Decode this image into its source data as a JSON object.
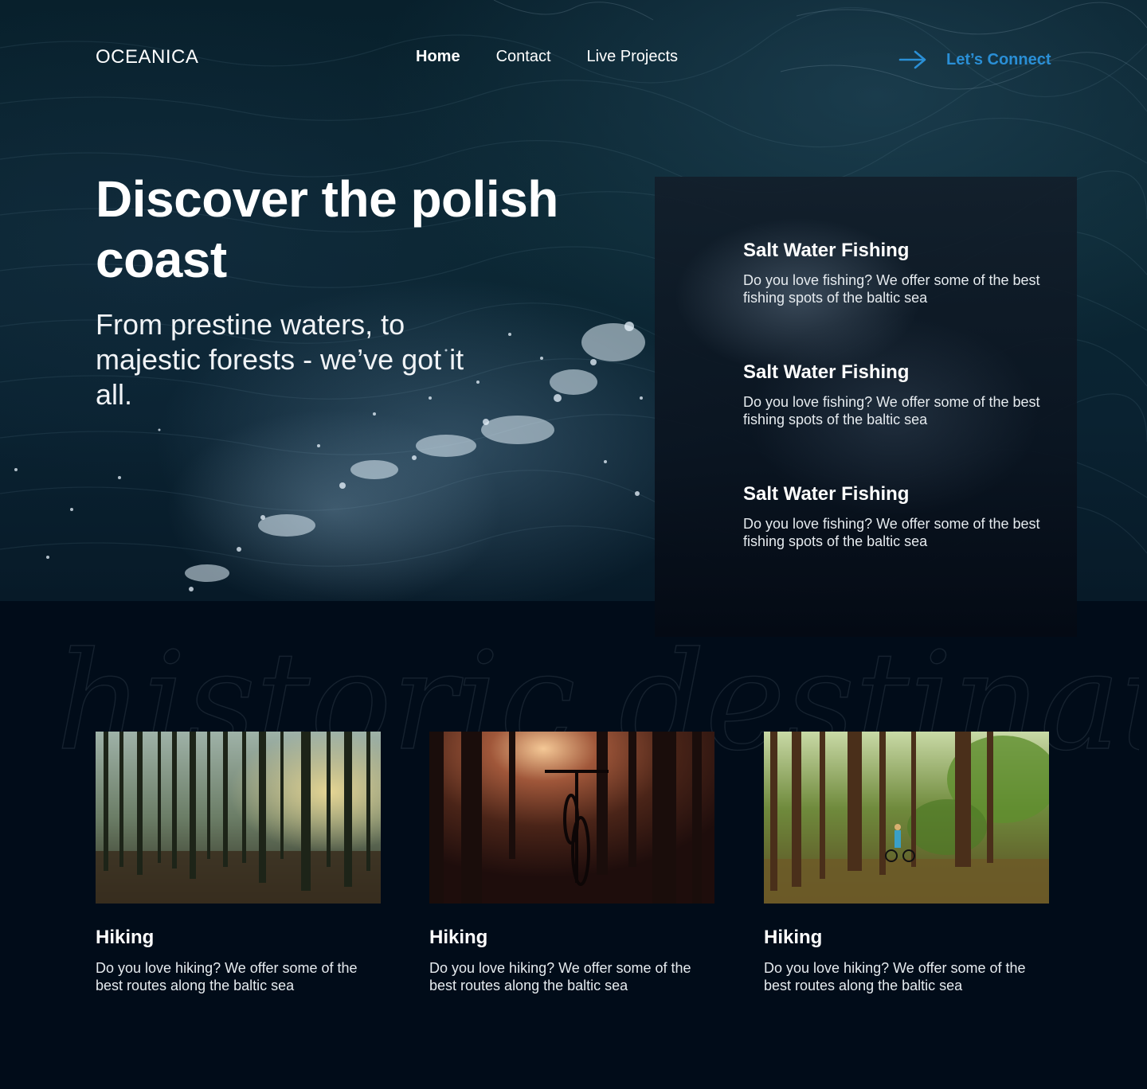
{
  "brand": {
    "logo": "OCEANICA"
  },
  "nav": {
    "items": [
      {
        "label": "Home",
        "active": true
      },
      {
        "label": "Contact",
        "active": false
      },
      {
        "label": "Live Projects",
        "active": false
      }
    ],
    "cta_label": "Let’s Connect",
    "cta_icon": "arrow-right-icon",
    "accent_color": "#2a8fd6"
  },
  "hero": {
    "title": "Discover the polish coast",
    "subtitle": "From prestine waters, to majestic forests - we’ve got it all.",
    "background_image": "ocean-waves-aerial-photo"
  },
  "features": [
    {
      "title": "Salt Water Fishing",
      "text": "Do you love fishing? We offer some of the best fishing spots of the baltic sea"
    },
    {
      "title": "Salt Water Fishing",
      "text": "Do you love fishing? We offer some of the best fishing spots of the baltic sea"
    },
    {
      "title": "Salt Water Fishing",
      "text": "Do you love fishing? We offer some of the best fishing spots of the baltic sea"
    }
  ],
  "destinations": {
    "script_heading": "historic destinations",
    "cards": [
      {
        "image": "misty-pine-forest-photo",
        "title": "Hiking",
        "text": "Do you love hiking? We offer some of the best routes along the baltic sea"
      },
      {
        "image": "bicycle-in-forest-sunset-photo",
        "title": "Hiking",
        "text": "Do you love hiking? We offer some of the best routes along the baltic sea"
      },
      {
        "image": "cyclist-in-green-forest-photo",
        "title": "Hiking",
        "text": "Do you love hiking? We offer some of the best routes along the baltic sea"
      }
    ]
  },
  "colors": {
    "page_background": "#010c19",
    "text": "#ffffff"
  }
}
